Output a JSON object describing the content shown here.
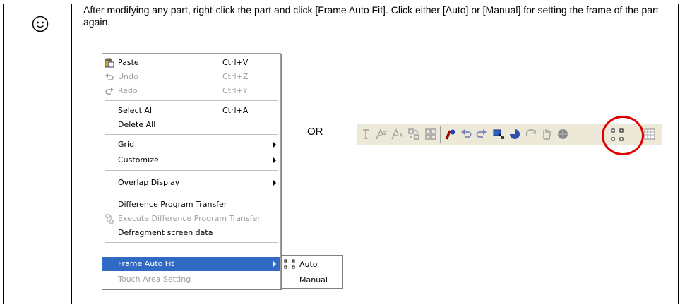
{
  "instruction": "After modifying any part, right-click the part and click [Frame Auto Fit].  Click either [Auto] or [Manual] for setting the frame of the part again.",
  "context_menu": {
    "paste": {
      "label": "Paste",
      "shortcut": "Ctrl+V"
    },
    "undo": {
      "label": "Undo",
      "shortcut": "Ctrl+Z"
    },
    "redo": {
      "label": "Redo",
      "shortcut": "Ctrl+Y"
    },
    "select_all": {
      "label": "Select All",
      "shortcut": "Ctrl+A"
    },
    "delete_all": {
      "label": "Delete All"
    },
    "grid": {
      "label": "Grid"
    },
    "customize": {
      "label": "Customize"
    },
    "overlap_display": {
      "label": "Overlap Display"
    },
    "difference_program_transfer": {
      "label": "Difference Program Transfer"
    },
    "execute_difference_program_transfer": {
      "label": "Execute Difference Program Transfer"
    },
    "defragment_screen_data": {
      "label": "Defragment screen data"
    },
    "frame_auto_fit": {
      "label": "Frame Auto Fit"
    },
    "touch_area_setting": {
      "label": "Touch Area Setting"
    }
  },
  "submenu": {
    "auto": {
      "label": "Auto"
    },
    "manual": {
      "label": "Manual"
    }
  },
  "or_text": "OR",
  "colors": {
    "highlight": "#316ac5",
    "circle": "#e00000",
    "disabled": "#a0a0a0",
    "toolbar_bg": "#ece9d8"
  },
  "icons": [
    "smiley-icon",
    "paste-icon",
    "undo-icon",
    "redo-icon",
    "execute-transfer-icon",
    "frame-auto-fit-icon"
  ]
}
